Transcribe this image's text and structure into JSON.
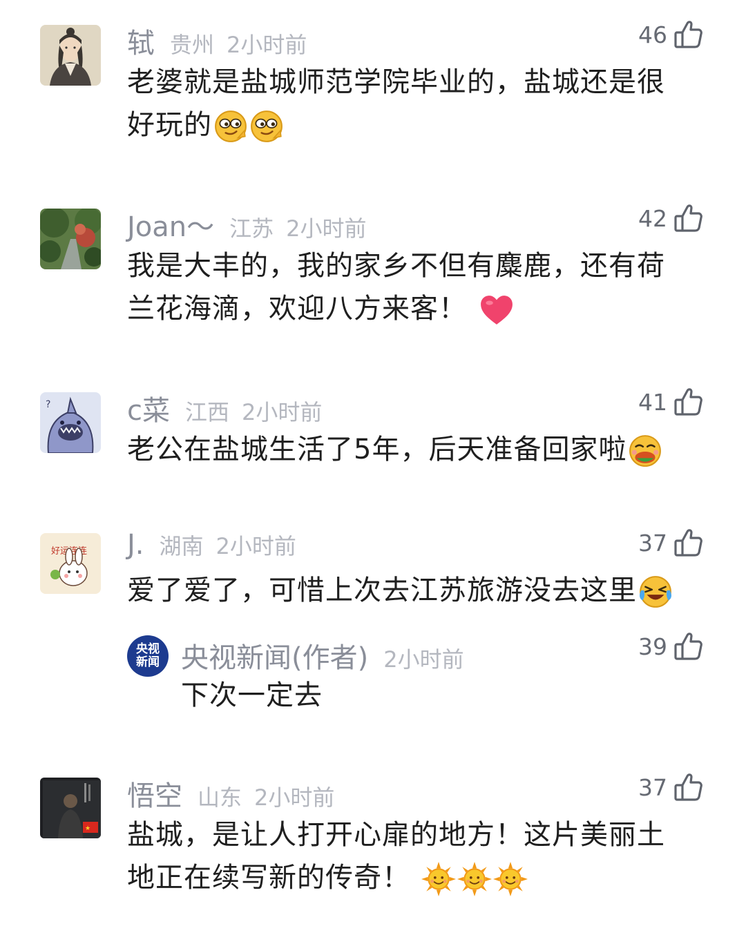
{
  "comments": [
    {
      "name": "轼",
      "location": "贵州",
      "time": "2小时前",
      "likes": "46",
      "avatar": "avatar-portrait",
      "line1": "老婆就是盐城师范学院毕业的，盐城还是很",
      "line2": "好玩的",
      "emojis": [
        "smug-face-emoji",
        "smug-face-emoji"
      ]
    },
    {
      "name": "Joan～",
      "location": "江苏",
      "time": "2小时前",
      "likes": "42",
      "avatar": "avatar-garden",
      "line1": "我是大丰的，我的家乡不但有麋鹿，还有荷",
      "line2": "兰花海滴，欢迎八方来客！",
      "emojis": [
        "heart-emoji"
      ]
    },
    {
      "name": "c菜",
      "location": "江西",
      "time": "2小时前",
      "likes": "41",
      "avatar": "avatar-shark-cartoon",
      "line1": "老公在盐城生活了5年，后天准备回家啦",
      "emojis": [
        "eating-face-emoji"
      ]
    },
    {
      "name": "J.",
      "location": "湖南",
      "time": "2小时前",
      "likes": "37",
      "avatar": "avatar-bunny-sticker",
      "line1": "爱了爱了，可惜上次去江苏旅游没去这里",
      "emojis": [
        "crying-laughing-emoji"
      ],
      "reply": {
        "name": "央视新闻(作者)",
        "logo_text_1": "央视",
        "logo_text_2": "新闻",
        "time": "2小时前",
        "likes": "39",
        "text": "下次一定去"
      }
    },
    {
      "name": "悟空",
      "location": "山东",
      "time": "2小时前",
      "likes": "37",
      "avatar": "avatar-dark-photo",
      "line1": "盐城，是让人打开心扉的地方！这片美丽土",
      "line2": "地正在续写新的传奇！",
      "emojis": [
        "sun-emoji",
        "sun-emoji",
        "sun-emoji"
      ]
    }
  ],
  "colors": {
    "name": "#8a8e99",
    "meta": "#b4b7bf",
    "text": "#1f1f1f",
    "like": "#666a73",
    "cctv_blue": "#1d3b8f"
  }
}
